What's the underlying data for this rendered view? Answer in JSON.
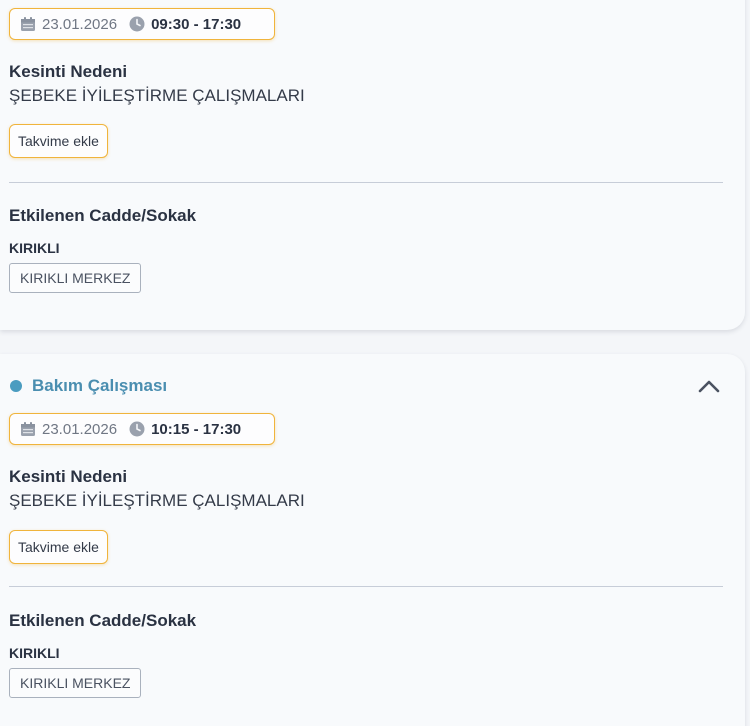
{
  "colors": {
    "accent_border": "#f0b43c",
    "status_blue": "#4a8eb0",
    "divider": "#c7cdd8"
  },
  "outages": [
    {
      "status": "",
      "date": "23.01.2026",
      "time_range": "09:30 - 17:30",
      "reason_label": "Kesinti Nedeni",
      "reason": "ŞEBEKE İYİLEŞTİRME ÇALIŞMALARI",
      "calendar_button": "Takvime ekle",
      "affected_label": "Etkilenen Cadde/Sokak",
      "district": "KIRIKLI",
      "streets": [
        "KIRIKLI MERKEZ"
      ]
    },
    {
      "status": "Bakım Çalışması",
      "date": "23.01.2026",
      "time_range": "10:15 - 17:30",
      "reason_label": "Kesinti Nedeni",
      "reason": "ŞEBEKE İYİLEŞTİRME ÇALIŞMALARI",
      "calendar_button": "Takvime ekle",
      "affected_label": "Etkilenen Cadde/Sokak",
      "district": "KIRIKLI",
      "streets": [
        "KIRIKLI MERKEZ"
      ],
      "expanded_icon": "chevron-up-icon"
    }
  ],
  "icons": {
    "date": "calendar-icon",
    "time": "clock-icon"
  }
}
